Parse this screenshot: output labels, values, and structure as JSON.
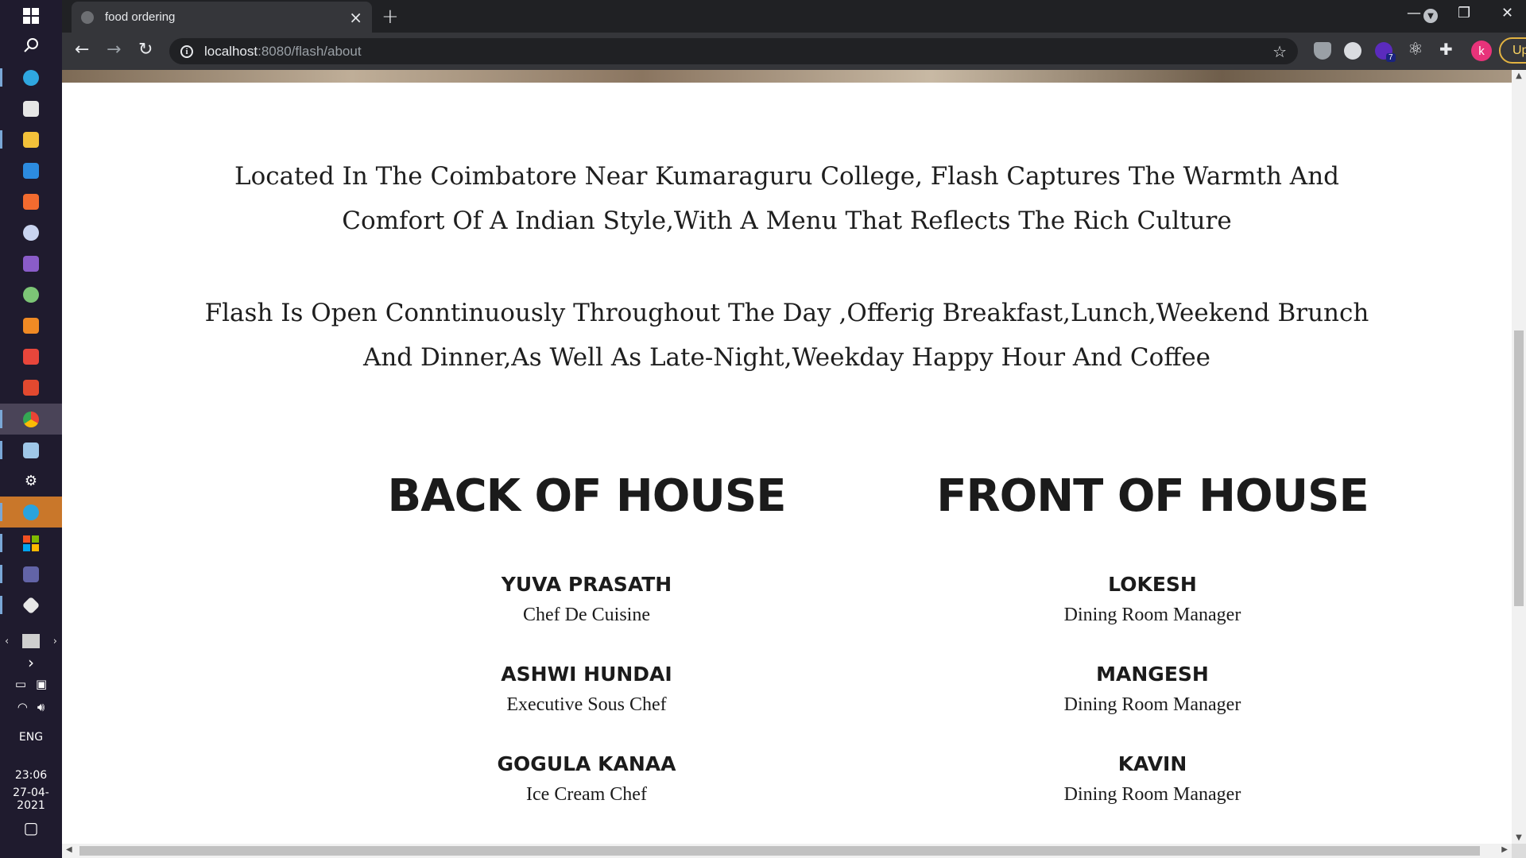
{
  "taskbar": {
    "apps": [
      {
        "name": "start",
        "color": "#ffffff"
      },
      {
        "name": "search",
        "color": "#ffffff"
      },
      {
        "name": "edge",
        "color": "#2fa7e0"
      },
      {
        "name": "store",
        "color": "#e6e6e6"
      },
      {
        "name": "file-explorer",
        "color": "#f3c13a"
      },
      {
        "name": "mail",
        "color": "#2c8be0"
      },
      {
        "name": "xampp",
        "color": "#f26b2f"
      },
      {
        "name": "media",
        "color": "#c9d4f0"
      },
      {
        "name": "visual-studio",
        "color": "#8a5cc9"
      },
      {
        "name": "android-studio",
        "color": "#7cc576"
      },
      {
        "name": "sublime",
        "color": "#f08a24"
      },
      {
        "name": "alarm",
        "color": "#e8463b"
      },
      {
        "name": "office",
        "color": "#e2492f"
      },
      {
        "name": "chrome",
        "color": "#3fae5a"
      },
      {
        "name": "notepad",
        "color": "#9fc7e8"
      },
      {
        "name": "settings",
        "color": "#ffffff"
      },
      {
        "name": "telegram",
        "color": "#2aa3de"
      },
      {
        "name": "microsoft",
        "color": "#7fba00"
      },
      {
        "name": "teams",
        "color": "#6264a7"
      },
      {
        "name": "git",
        "color": "#e8e8e8"
      }
    ],
    "language": "ENG",
    "time": "23:06",
    "date": "27-04-2021"
  },
  "browser": {
    "tab_title": "food ordering",
    "url_host": "localhost",
    "url_path": ":8080/flash/about",
    "profile_initial": "k",
    "update_label": "Update",
    "ext_badge": "7"
  },
  "about": {
    "paragraph1_line1": "Located In The Coimbatore Near Kumaraguru College, Flash Captures The Warmth And",
    "paragraph1_line2": "Comfort Of A Indian Style,With A Menu That Reflects The Rich Culture",
    "paragraph2_line1": "Flash Is Open Conntinuously Throughout The Day ,Offerig Breakfast,Lunch,Weekend Brunch",
    "paragraph2_line2": "And Dinner,As Well As Late-Night,Weekday Happy Hour And Coffee"
  },
  "back_of_house": {
    "heading": "BACK OF HOUSE",
    "members": [
      {
        "name": "YUVA PRASATH",
        "role": "Chef De Cuisine"
      },
      {
        "name": "ASHWI HUNDAI",
        "role": "Executive Sous Chef"
      },
      {
        "name": "GOGULA KANAA",
        "role": "Ice Cream Chef"
      }
    ]
  },
  "front_of_house": {
    "heading": "FRONT OF HOUSE",
    "members": [
      {
        "name": "LOKESH",
        "role": "Dining Room Manager"
      },
      {
        "name": "MANGESH",
        "role": "Dining Room Manager"
      },
      {
        "name": "KAVIN",
        "role": "Dining Room Manager"
      }
    ]
  }
}
